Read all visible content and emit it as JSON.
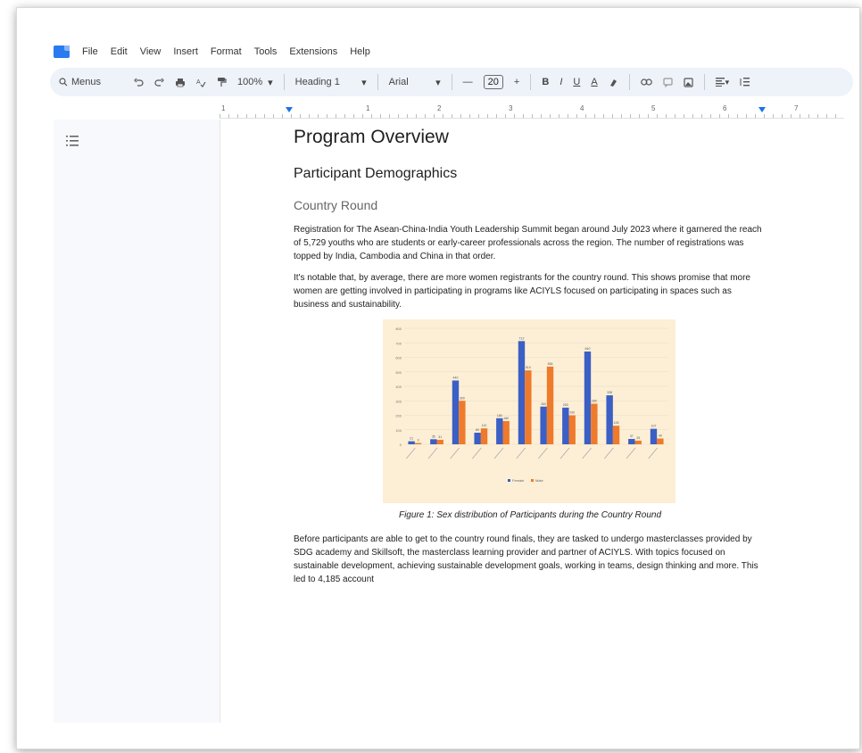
{
  "menubar": {
    "items": [
      "File",
      "Edit",
      "View",
      "Insert",
      "Format",
      "Tools",
      "Extensions",
      "Help"
    ]
  },
  "toolbar": {
    "search_label": "Menus",
    "zoom": "100%",
    "style": "Heading 1",
    "font": "Arial",
    "font_size": "20",
    "bold": "B",
    "italic": "I",
    "underline": "U",
    "text_color": "A"
  },
  "ruler": {
    "numbers": [
      "1",
      "1",
      "2",
      "3",
      "4",
      "5",
      "6",
      "7"
    ]
  },
  "document": {
    "title": "Program Overview",
    "heading2": "Participant Demographics",
    "heading3": "Country Round",
    "para1": "Registration for The Asean-China-India Youth Leadership Summit began around July 2023 where it garnered the reach of 5,729 youths who are students or early-career professionals across the region. The number of registrations was topped by India, Cambodia and China in that order.",
    "para2": "It's notable that, by average, there are more women registrants for the country round. This shows promise that more women are getting involved in participating in programs like ACIYLS focused on participating in spaces such as business and sustainability.",
    "caption": "Figure 1: Sex distribution of Participants during the Country Round",
    "para3": "Before participants are able to get to the country round finals, they are tasked to undergo masterclasses provided by SDG academy and Skillsoft, the masterclass learning provider and partner of ACIYLS. With topics focused on sustainable development, achieving sustainable development goals, working in teams, design thinking and more. This led to 4,185 account"
  },
  "chart_data": {
    "type": "bar",
    "ylim": [
      0,
      800
    ],
    "yticks": [
      "0",
      "100",
      "200",
      "300",
      "400",
      "500",
      "600",
      "700",
      "800"
    ],
    "series": [
      {
        "name": "Female",
        "color": "#3b5fc4",
        "values": [
          21,
          35,
          440,
          80,
          180,
          712,
          260,
          253,
          640,
          338,
          37,
          107
        ]
      },
      {
        "name": "Male",
        "color": "#ef7a2c",
        "values": [
          9,
          31,
          300,
          110,
          160,
          510,
          536,
          200,
          280,
          128,
          25,
          40
        ]
      }
    ],
    "legend_position": "bottom",
    "background": "#fcefd6"
  },
  "colors": {
    "accent": "#1a73e8",
    "toolbar_bg": "#eef2f9"
  }
}
